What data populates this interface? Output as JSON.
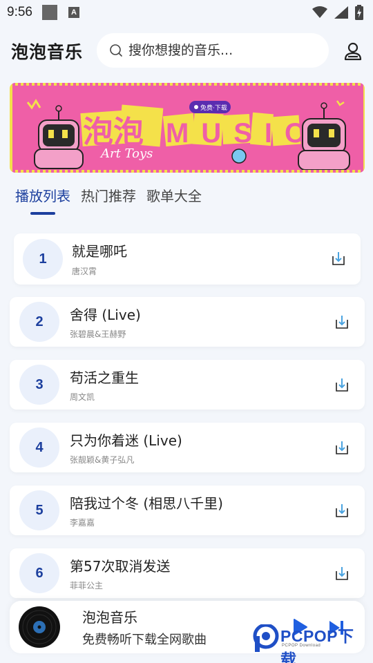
{
  "status_bar": {
    "time": "9:56",
    "notification_letter": "A"
  },
  "header": {
    "title": "泡泡音乐",
    "search_placeholder": "搜你想搜的音乐..."
  },
  "banner": {
    "title_cn": "泡泡",
    "title_en": "MUSIC",
    "badge": "免费·下载",
    "script_text": "Art Toys"
  },
  "tabs": [
    {
      "label": "播放列表",
      "active": true
    },
    {
      "label": "热门推荐",
      "active": false
    },
    {
      "label": "歌单大全",
      "active": false
    }
  ],
  "songs": [
    {
      "num": "1",
      "title": "就是哪吒",
      "artist": "唐汉霄"
    },
    {
      "num": "2",
      "title": "舍得 (Live)",
      "artist": "张碧晨&王赫野"
    },
    {
      "num": "3",
      "title": "苟活之重生",
      "artist": "周文凯"
    },
    {
      "num": "4",
      "title": "只为你着迷 (Live)",
      "artist": "张靓颖&黄子弘凡"
    },
    {
      "num": "5",
      "title": "陪我过个冬 (相思八千里)",
      "artist": "李嘉嘉"
    },
    {
      "num": "6",
      "title": "第57次取消发送",
      "artist": "菲菲公主"
    }
  ],
  "player": {
    "title": "泡泡音乐",
    "subtitle": "免费畅听下载全网歌曲"
  },
  "watermark": {
    "text": "PCPOP下载",
    "sub": "PCPOP Download"
  },
  "colors": {
    "accent": "#1c3f9e",
    "background": "#f3f6fb",
    "banner_pink": "#ef5fa7",
    "banner_yellow": "#f4e14a",
    "download_icon": "#4aa3e0"
  }
}
